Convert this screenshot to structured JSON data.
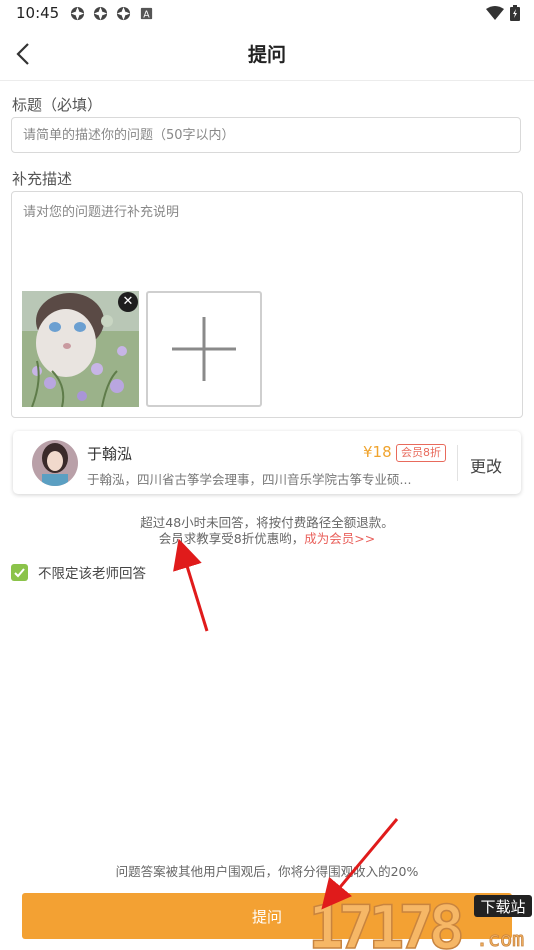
{
  "status_bar": {
    "time": "10:45",
    "icons": [
      "settings-icon",
      "settings-icon",
      "settings-icon",
      "a-icon",
      "wifi-icon",
      "battery-icon"
    ]
  },
  "header": {
    "title": "提问",
    "back_icon": "back-arrow-icon"
  },
  "form": {
    "title_label": "标题（必填）",
    "title_placeholder": "请简单的描述你的问题（50字以内）",
    "desc_label": "补充描述",
    "desc_placeholder": "请对您的问题进行补充说明"
  },
  "teacher": {
    "name": "于翰泓",
    "intro": "于翰泓，四川省古筝学会理事，四川音乐学院古筝专业硕...",
    "price": "¥18",
    "vip_badge": "会员8折",
    "change_label": "更改"
  },
  "notice": {
    "line1": "超过48小时未回答，将按付费路径全额退款。",
    "line2": "会员求教享受8折优惠哟，",
    "become_member": "成为会员>>"
  },
  "checkbox": {
    "label": "不限定该老师回答",
    "checked": true
  },
  "bottom": {
    "notice": "问题答案被其他用户围观后，你将分得围观收入的20%",
    "submit_label": "提问"
  },
  "watermark": {
    "text": "17178",
    "sub1": "下载站",
    "sub2": ".com"
  },
  "colors": {
    "accent": "#f3a133",
    "link": "#e9605b",
    "check": "#8bc34a",
    "price": "#f0a42f"
  }
}
